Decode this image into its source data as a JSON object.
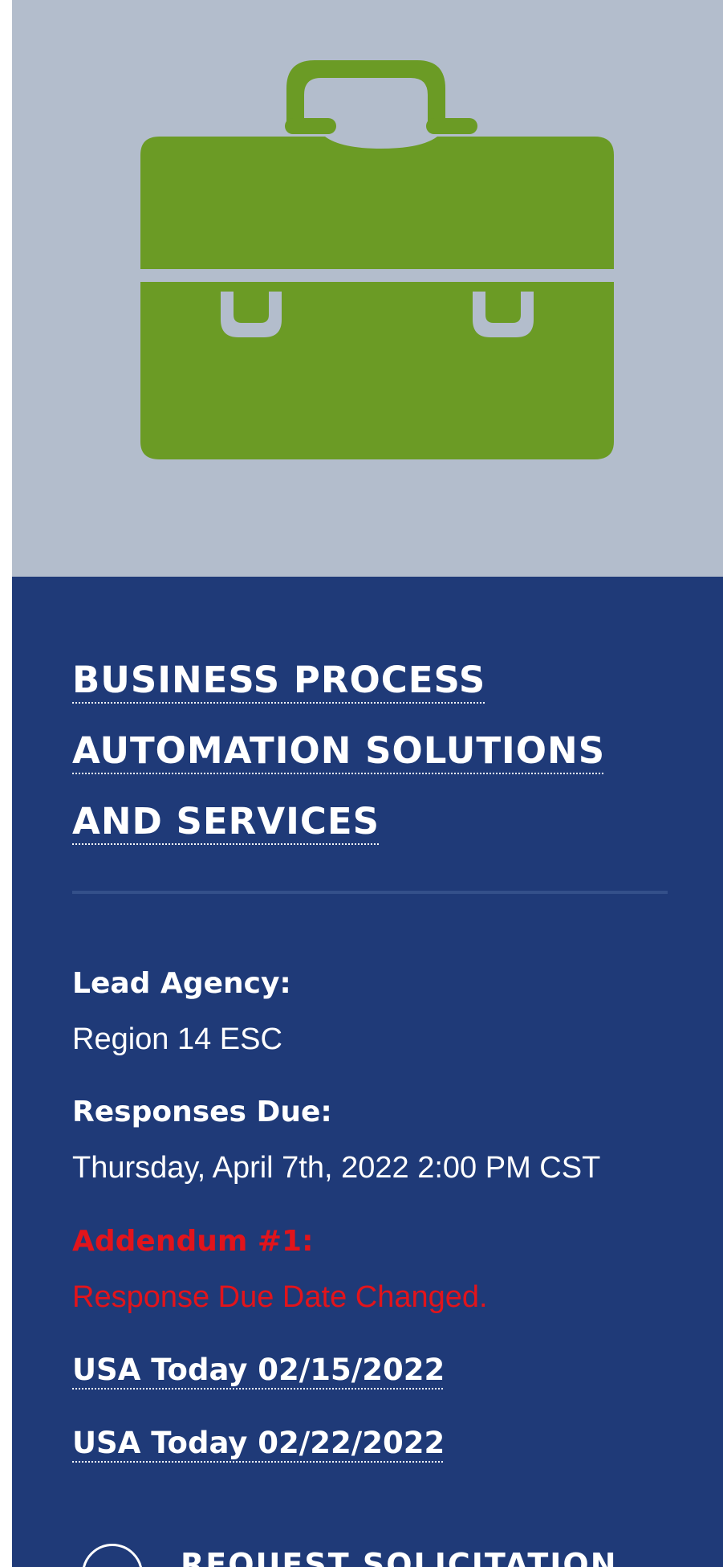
{
  "hero": {
    "icon": "briefcase-icon",
    "icon_color": "#6b9b25",
    "background_color": "#b3bdcc"
  },
  "panel": {
    "background_color": "#1f3a78",
    "title_lines": [
      "BUSINESS PROCESS",
      "AUTOMATION SOLUTIONS",
      "AND SERVICES"
    ],
    "lead_agency_label": "Lead Agency:",
    "lead_agency_value": "Region 14 ESC",
    "responses_due_label": "Responses Due:",
    "responses_due_value": "Thursday, April 7th, 2022 2:00 PM CST",
    "addendum_label": "Addendum #1:",
    "addendum_value": "Response Due Date Changed.",
    "addendum_color": "#e2141b",
    "links": [
      "USA Today 02/15/2022",
      "USA Today 02/22/2022"
    ],
    "request_button": {
      "icon": "circle-arrow-icon",
      "label": "REQUEST SOLICITATION"
    }
  }
}
